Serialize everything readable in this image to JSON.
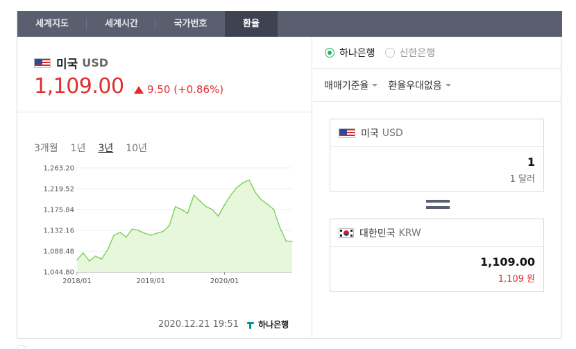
{
  "tabs": [
    {
      "label": "세계지도",
      "active": false
    },
    {
      "label": "세계시간",
      "active": false
    },
    {
      "label": "국가번호",
      "active": false
    },
    {
      "label": "환율",
      "active": true
    }
  ],
  "summary": {
    "country": "미국",
    "currency_code": "USD",
    "rate": "1,109.00",
    "change": "9.50",
    "change_pct": "(+0.86%)",
    "direction": "up",
    "color": "#e02d2d"
  },
  "periods": [
    {
      "label": "3개월",
      "active": false
    },
    {
      "label": "1년",
      "active": false
    },
    {
      "label": "3년",
      "active": true
    },
    {
      "label": "10년",
      "active": false
    }
  ],
  "timestamp": "2020.12.21 19:51",
  "bank_logo_text": "하나은행",
  "banks": [
    {
      "label": "하나은행",
      "selected": true
    },
    {
      "label": "신한은행",
      "selected": false
    }
  ],
  "options": [
    {
      "label": "매매기준율"
    },
    {
      "label": "환율우대없음"
    }
  ],
  "from": {
    "country": "미국",
    "currency_code": "USD",
    "amount": "1",
    "unit_text": "1 달러"
  },
  "to": {
    "country": "대한민국",
    "currency_code": "KRW",
    "amount": "1,109.00",
    "unit_text": "1,109 원"
  },
  "chart_data": {
    "type": "area",
    "y_ticks": [
      "1,263.20",
      "1,219.52",
      "1,175.84",
      "1,132.16",
      "1,088.48",
      "1,044.80"
    ],
    "y_tick_values": [
      1263.2,
      1219.52,
      1175.84,
      1132.16,
      1088.48,
      1044.8
    ],
    "ylim": [
      1044.8,
      1263.2
    ],
    "x_ticks": [
      "2018/01",
      "2019/01",
      "2020/01"
    ],
    "x_tick_values": [
      "2018-01",
      "2019-01",
      "2020-01"
    ],
    "xlim": [
      "2018-01",
      "2020-12"
    ],
    "line_color": "#7fcf5c",
    "fill_color": "#e6f7dc",
    "grid": true,
    "x": [
      "2018-01",
      "2018-02",
      "2018-03",
      "2018-04",
      "2018-05",
      "2018-06",
      "2018-07",
      "2018-08",
      "2018-09",
      "2018-10",
      "2018-11",
      "2018-12",
      "2019-01",
      "2019-02",
      "2019-03",
      "2019-04",
      "2019-05",
      "2019-06",
      "2019-07",
      "2019-08",
      "2019-09",
      "2019-10",
      "2019-11",
      "2019-12",
      "2020-01",
      "2020-02",
      "2020-03",
      "2020-04",
      "2020-05",
      "2020-06",
      "2020-07",
      "2020-08",
      "2020-09",
      "2020-10",
      "2020-11",
      "2020-12"
    ],
    "values": [
      1070,
      1085,
      1068,
      1078,
      1072,
      1092,
      1122,
      1128,
      1118,
      1135,
      1132,
      1126,
      1122,
      1126,
      1130,
      1142,
      1182,
      1176,
      1168,
      1206,
      1194,
      1182,
      1176,
      1162,
      1186,
      1206,
      1222,
      1232,
      1238,
      1212,
      1196,
      1187,
      1176,
      1138,
      1110,
      1109
    ]
  }
}
